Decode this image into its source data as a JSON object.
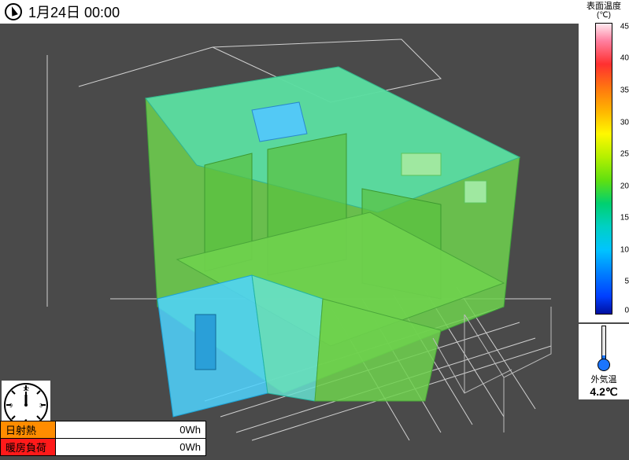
{
  "header": {
    "datetime": "1月24日 00:00"
  },
  "legend": {
    "title": "表面温度",
    "unit": "(℃)",
    "ticks": [
      "45",
      "40",
      "35",
      "30",
      "25",
      "20",
      "15",
      "10",
      "5",
      "0"
    ]
  },
  "outside": {
    "label": "外気温",
    "value": "4.2℃"
  },
  "metrics": {
    "solar": {
      "label": "日射熱",
      "value": "0Wh"
    },
    "heating": {
      "label": "暖房負荷",
      "value": "0Wh"
    }
  }
}
